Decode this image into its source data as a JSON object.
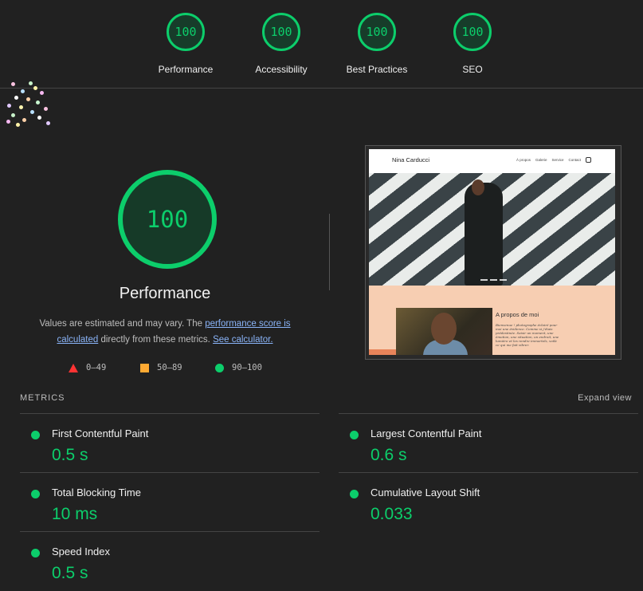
{
  "scores": [
    {
      "value": "100",
      "label": "Performance"
    },
    {
      "value": "100",
      "label": "Accessibility"
    },
    {
      "value": "100",
      "label": "Best Practices"
    },
    {
      "value": "100",
      "label": "SEO"
    }
  ],
  "main": {
    "score": "100",
    "title": "Performance",
    "desc_before": "Values are estimated and may vary. The ",
    "link_score": "performance score is calculated",
    "desc_middle": " directly from these metrics. ",
    "link_calc": "See calculator.",
    "legend": {
      "fail": "0–49",
      "average": "50–89",
      "pass": "90–100"
    }
  },
  "preview": {
    "site_name": "Nina Carducci",
    "nav": [
      "À propos",
      "Galerie",
      "Service",
      "Contact"
    ],
    "about_title": "A propos de moi",
    "about_text": "Bienvenue ! photographe éclairé pour moi une évidence. Comme si j'étais prédestinée. Saisir un moment, une émotion, une situation, un endroit, une lumière et les rendre immortels, voilà ce qui me fait vibrer."
  },
  "metrics_section": {
    "heading": "METRICS",
    "expand": "Expand view"
  },
  "metrics": [
    {
      "name": "First Contentful Paint",
      "value": "0.5 s"
    },
    {
      "name": "Largest Contentful Paint",
      "value": "0.6 s"
    },
    {
      "name": "Total Blocking Time",
      "value": "10 ms"
    },
    {
      "name": "Cumulative Layout Shift",
      "value": "0.033"
    },
    {
      "name": "Speed Index",
      "value": "0.5 s"
    }
  ],
  "colors": {
    "pass": "#0cce6b",
    "average": "#ffaa33",
    "fail": "#ff3333",
    "link": "#8ab4f8"
  }
}
